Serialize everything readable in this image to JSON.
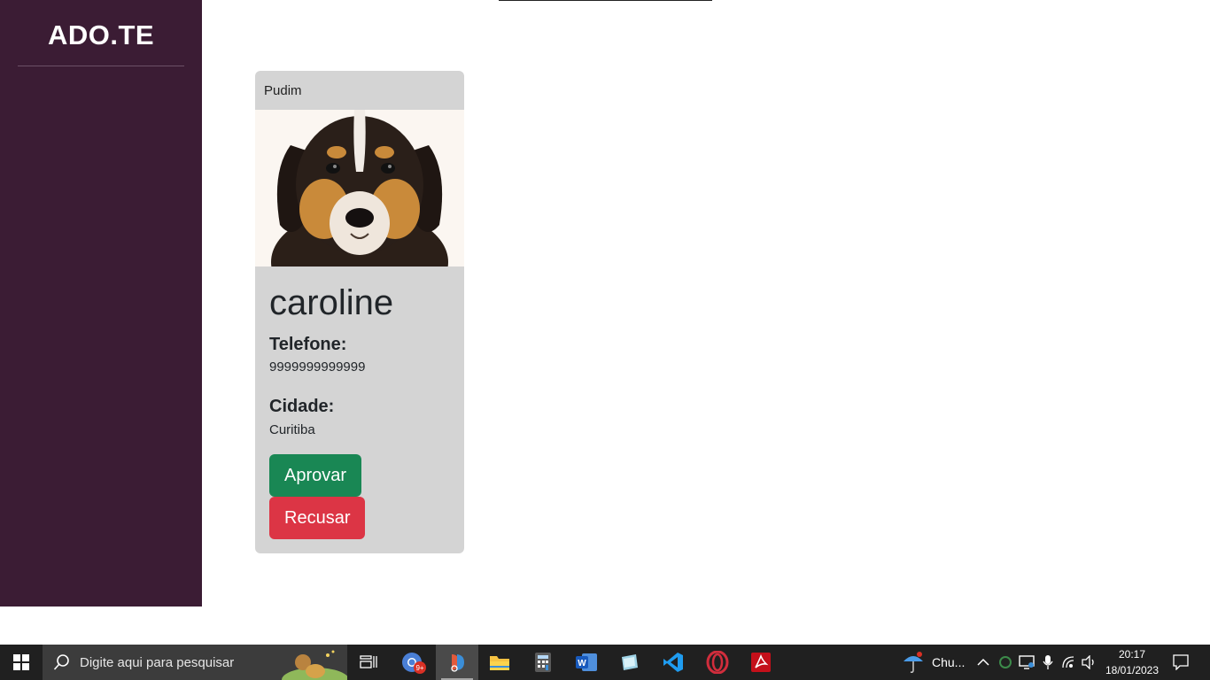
{
  "sidebar": {
    "brand": "ADO.TE"
  },
  "card": {
    "header": "Pudim",
    "owner_name": "caroline",
    "phone_label": "Telefone:",
    "phone_value": "9999999999999",
    "city_label": "Cidade:",
    "city_value": "Curitiba",
    "approve_label": "Aprovar",
    "reject_label": "Recusar"
  },
  "taskbar": {
    "search_placeholder": "Digite aqui para pesquisar",
    "weather_text": "Chu...",
    "time": "20:17",
    "date": "18/01/2023",
    "chrome_badge": "9+"
  }
}
